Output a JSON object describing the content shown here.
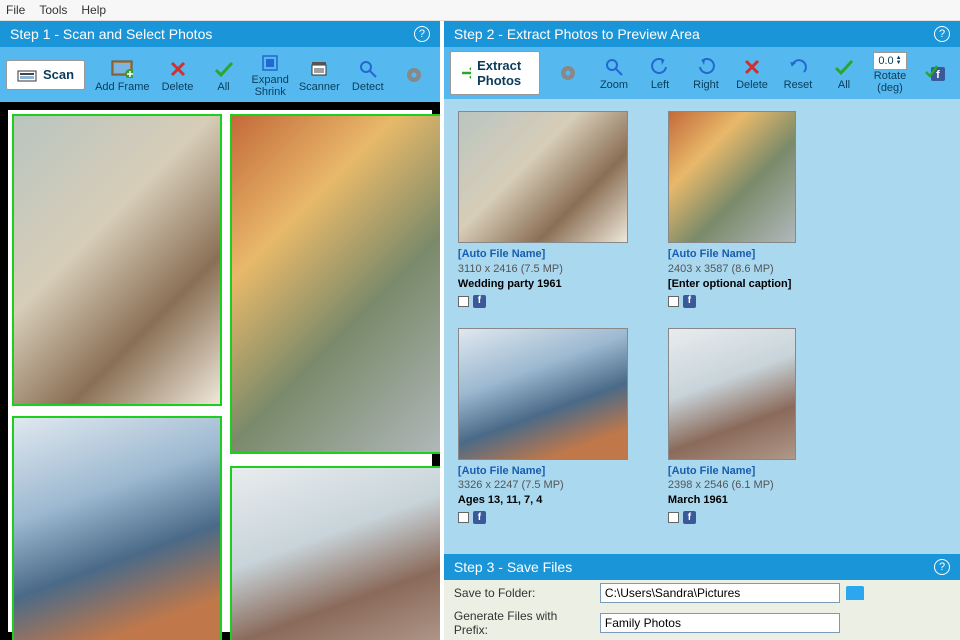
{
  "menu": {
    "file": "File",
    "tools": "Tools",
    "help": "Help"
  },
  "step1": {
    "title": "Step 1 - Scan and Select Photos",
    "scan_btn": "Scan",
    "tools": {
      "add_frame": "Add Frame",
      "delete": "Delete",
      "all": "All",
      "expand": "Expand",
      "shrink": "Shrink",
      "scanner": "Scanner",
      "detect": "Detect"
    }
  },
  "step2": {
    "title": "Step 2 - Extract Photos to Preview Area",
    "extract_btn": "Extract Photos",
    "tools": {
      "zoom": "Zoom",
      "left": "Left",
      "right": "Right",
      "delete": "Delete",
      "reset": "Reset",
      "all": "All",
      "rotate": "Rotate (deg)",
      "rotate_val": "0.0"
    },
    "items": [
      {
        "autoname": "[Auto File Name]",
        "dims": "3110 x 2416 (7.5 MP)",
        "caption": "Wedding party 1961"
      },
      {
        "autoname": "[Auto File Name]",
        "dims": "2403 x 3587 (8.6 MP)",
        "caption": "[Enter optional caption]"
      },
      {
        "autoname": "[Auto File Name]",
        "dims": "3326 x 2247 (7.5 MP)",
        "caption": "Ages 13, 11, 7, 4"
      },
      {
        "autoname": "[Auto File Name]",
        "dims": "2398 x 2546 (6.1 MP)",
        "caption": "March 1961"
      }
    ]
  },
  "step3": {
    "title": "Step 3 - Save Files",
    "save_to_label": "Save to Folder:",
    "save_to_value": "C:\\Users\\Sandra\\Pictures",
    "prefix_label": "Generate Files with Prefix:",
    "prefix_value": "Family Photos"
  },
  "thumbs": {
    "p1": "linear-gradient(135deg,#b9c5c0 0%,#d7cdb8 40%,#8a6f55 70%,#efe8da 100%)",
    "p2": "linear-gradient(135deg,#c46a3a 0%,#e8b96a 30%,#7a8a6a 60%,#b0b8ba 100%)",
    "p3": "linear-gradient(160deg,#dfe8ef 0%,#9cb8d0 35%,#4a6a88 60%,#c0784a 85%)",
    "p4": "linear-gradient(160deg,#e8ecee 0%,#c8d4da 40%,#8a6a5a 70%,#b0988a 100%)"
  }
}
